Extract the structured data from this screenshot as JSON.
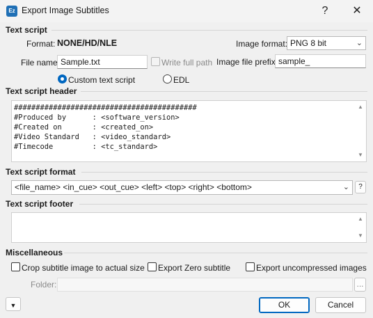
{
  "window": {
    "title": "Export Image Subtitles",
    "app_icon_text": "Ez",
    "help_button": "?",
    "close_button": "✕"
  },
  "text_script": {
    "section_title": "Text script",
    "format_label": "Format:",
    "format_value": "NONE/HD/NLE",
    "image_format_label": "Image format:",
    "image_format_value": "PNG 8 bit",
    "file_name_label": "File name:",
    "file_name_value": "Sample.txt",
    "write_full_path_label": "Write full path",
    "image_prefix_label": "Image file prefix:",
    "image_prefix_value": "sample_",
    "radio_custom_label": "Custom text script",
    "radio_edl_label": "EDL",
    "selected_radio": "Custom text script"
  },
  "header": {
    "section_title": "Text script header",
    "content": "##########################################\n#Produced by      : <software_version>\n#Created on       : <created_on>\n#Video Standard   : <video_standard>\n#Timecode         : <tc_standard>"
  },
  "format": {
    "section_title": "Text script format",
    "value": "<file_name> <in_cue> <out_cue> <left> <top> <right> <bottom>",
    "help_button": "?"
  },
  "footer": {
    "section_title": "Text script footer",
    "content": ""
  },
  "misc": {
    "section_title": "Miscellaneous",
    "crop_label": "Crop subtitle image to actual size",
    "export_zero_label": "Export Zero subtitle",
    "export_uncompressed_label": "Export uncompressed images",
    "folder_label": "Folder:",
    "folder_value": "",
    "browse_button": "..."
  },
  "buttons": {
    "ok": "OK",
    "cancel": "Cancel"
  },
  "colors": {
    "accent": "#0067c0",
    "background": "#f0f0f0"
  }
}
